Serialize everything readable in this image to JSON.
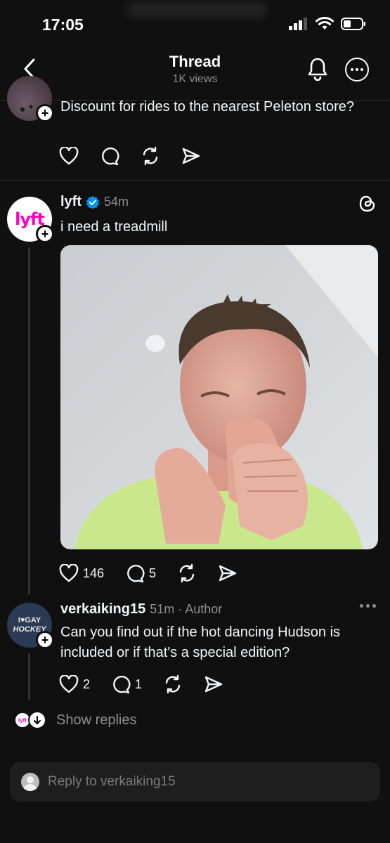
{
  "status_bar": {
    "time": "17:05"
  },
  "header": {
    "title": "Thread",
    "subtitle": "1K views"
  },
  "prev_post": {
    "text": "Discount for rides to the nearest Peleton store?"
  },
  "main_post": {
    "username": "lyft",
    "time": "54m",
    "avatar_text": "lyft",
    "text": "i need a treadmill",
    "likes": "146",
    "replies": "5"
  },
  "reply_post": {
    "username": "verkaiking15",
    "meta": "51m · Author",
    "avatar_text_line1": "I♥GAY",
    "avatar_text_line2": "HOCKEY",
    "text": "Can you find out if the hot dancing Hudson is included or if that's a special edition?",
    "likes": "2",
    "replies": "1"
  },
  "show_replies": {
    "label": "Show replies"
  },
  "reply_input": {
    "placeholder": "Reply to verkaiking15"
  },
  "colors": {
    "background": "#101010",
    "text": "#f3f5f7",
    "muted": "#8e8e8e",
    "verified": "#0095f6",
    "lyft_pink": "#ff00bf"
  }
}
